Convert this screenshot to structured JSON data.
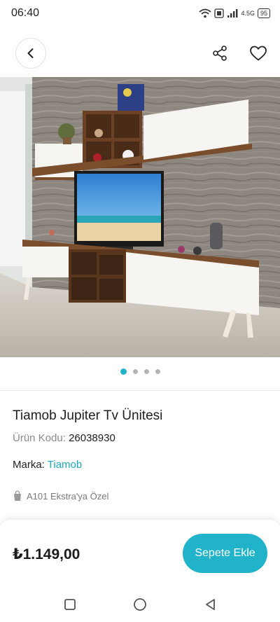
{
  "status_bar": {
    "time": "06:40",
    "network": "4.5G",
    "battery": "95"
  },
  "nav": {
    "back_icon": "chevron-left-icon",
    "share_icon": "share-icon",
    "favorite_icon": "heart-icon"
  },
  "gallery": {
    "image_count": 4,
    "active_index": 0
  },
  "product": {
    "title": "Tiamob Jupiter Tv Ünitesi",
    "code_label": "Ürün Kodu:",
    "code_value": "26038930",
    "brand_label": "Marka:",
    "brand_value": "Tiamob",
    "special_label": "A101 Ekstra'ya Özel"
  },
  "purchase": {
    "price": "₺1.149,00",
    "add_to_cart_label": "Sepete Ekle"
  },
  "system_nav": {
    "recent_icon": "square-icon",
    "home_icon": "circle-icon",
    "back_icon": "triangle-back-icon"
  },
  "colors": {
    "accent": "#21b3c9",
    "link": "#1fa9bf",
    "text": "#1e1e1e",
    "muted": "#8a8a8a"
  }
}
